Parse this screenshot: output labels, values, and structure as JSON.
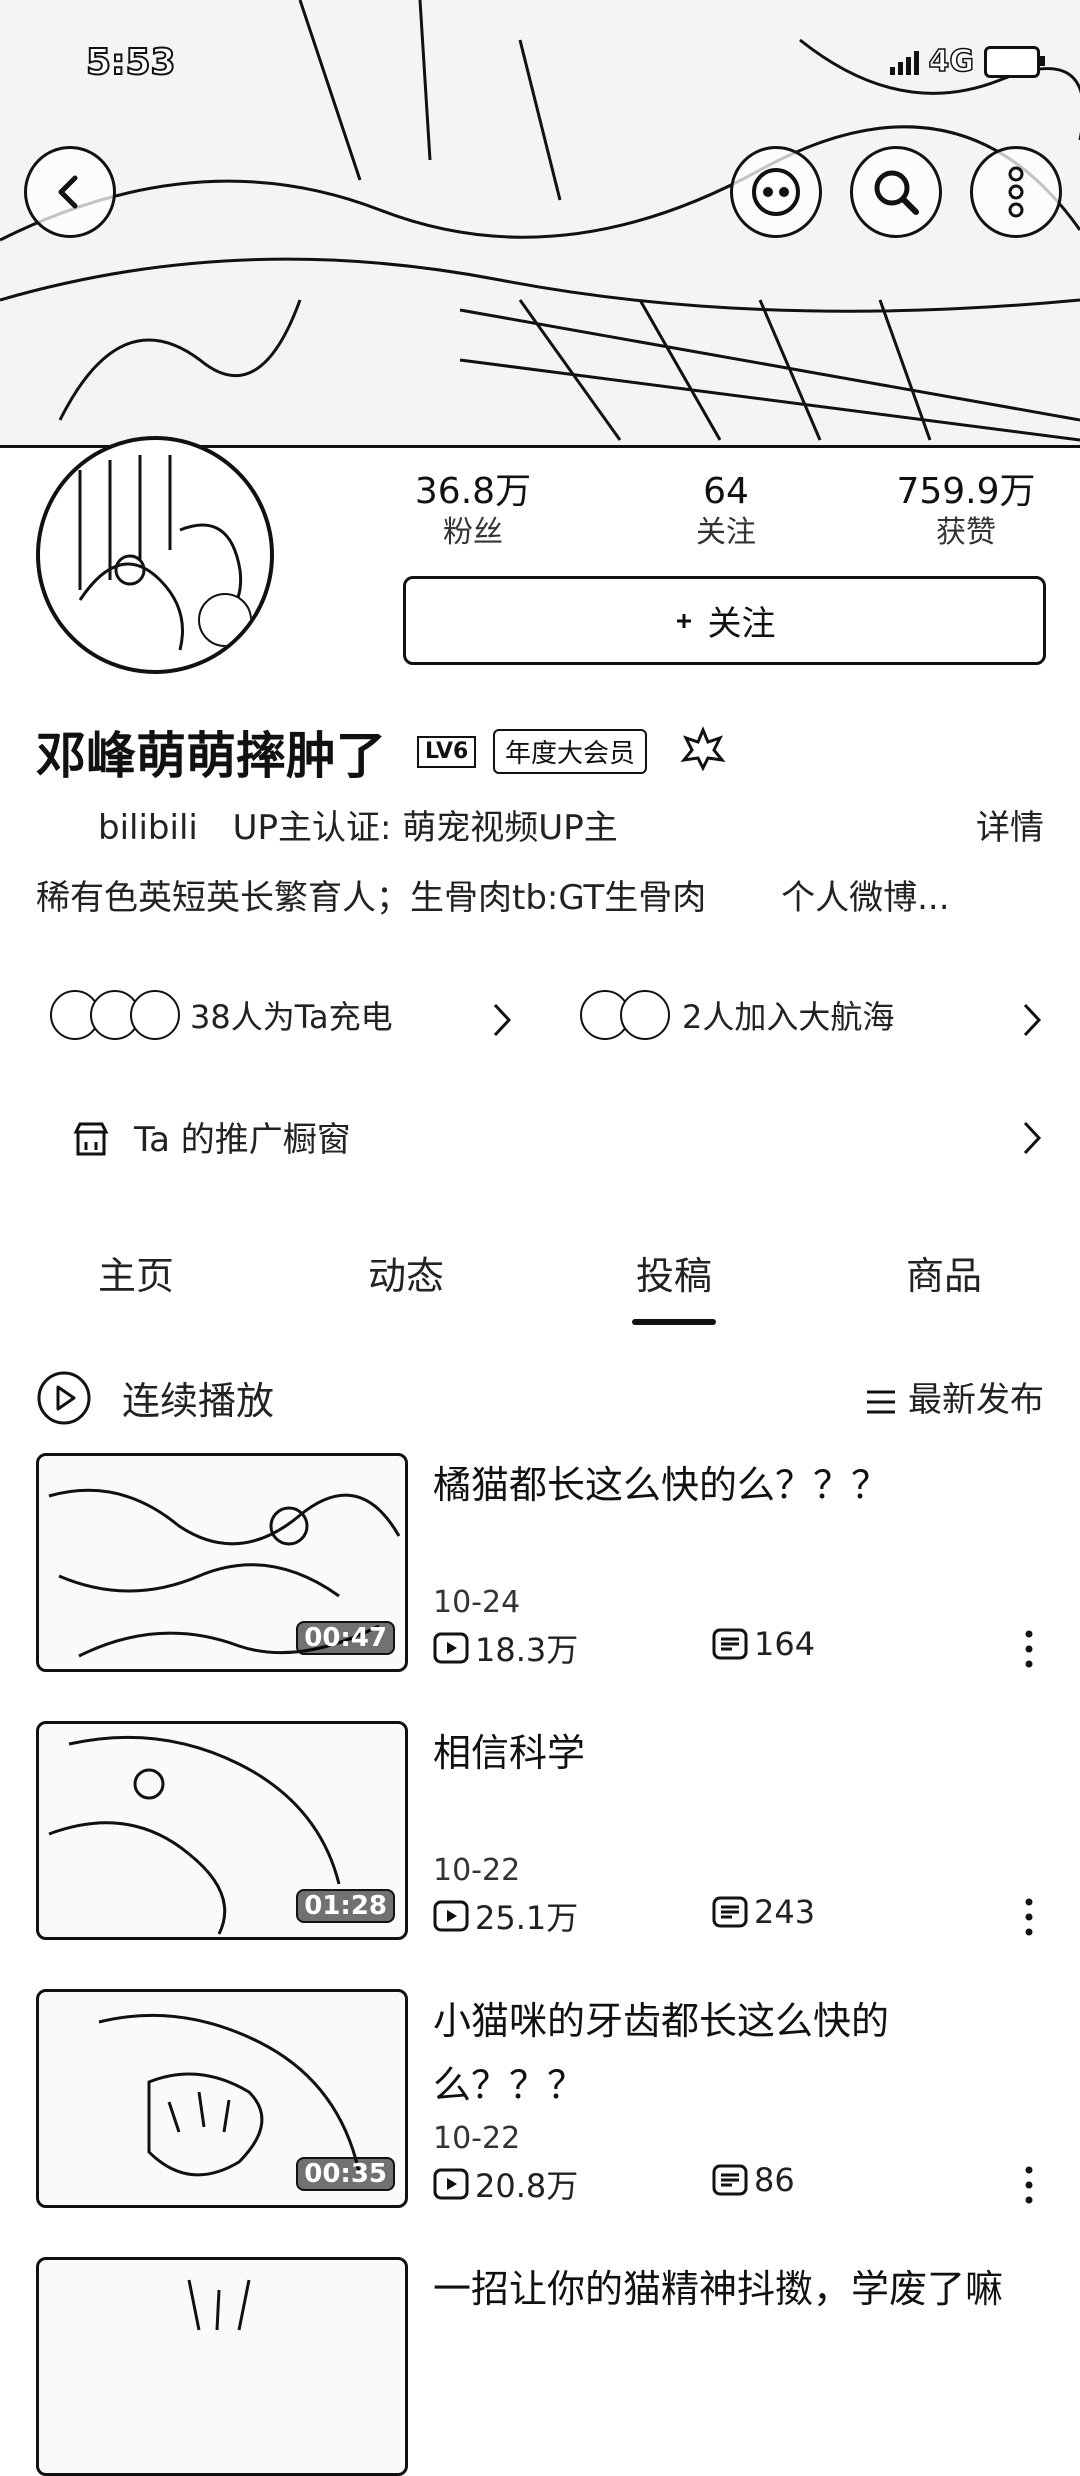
{
  "status": {
    "time": "5:53",
    "network": "4G"
  },
  "stats": [
    {
      "value": "36.8万",
      "label": "粉丝"
    },
    {
      "value": "64",
      "label": "关注"
    },
    {
      "value": "759.9万",
      "label": "获赞"
    }
  ],
  "follow_label": "关注",
  "profile": {
    "name": "邓峰萌萌摔肿了",
    "level_badge": "LV6",
    "vip_badge": "年度大会员",
    "cert_source": "bilibili",
    "cert_text": "UP主认证:  萌宠视频UP主",
    "detail_link": "详情",
    "bio": "稀有色英短英长繁育人；生骨肉tb:GT生骨肉",
    "weibo": "个人微博..."
  },
  "charge": {
    "text": "38人为Ta充电"
  },
  "fleet": {
    "text": "2人加入大航海"
  },
  "showcase": {
    "text": "Ta 的推广橱窗"
  },
  "tabs": [
    "主页",
    "动态",
    "投稿",
    "商品"
  ],
  "active_tab": "投稿",
  "play_all": "连续播放",
  "sort": "最新发布",
  "videos": [
    {
      "title": "橘猫都长这么快的么？？？",
      "date": "10-24",
      "plays": "18.3万",
      "danmaku": "164",
      "duration": "00:47"
    },
    {
      "title": "相信科学",
      "date": "10-22",
      "plays": "25.1万",
      "danmaku": "243",
      "duration": "01:28"
    },
    {
      "title": "小猫咪的牙齿都长这么快的么？？？",
      "date": "10-22",
      "plays": "20.8万",
      "danmaku": "86",
      "duration": "00:35"
    },
    {
      "title": "一招让你的猫精神抖擞，学废了嘛"
    }
  ],
  "icons": {
    "back": "chevron-left-icon",
    "face": "bilibili-face-icon",
    "search": "search-icon",
    "more": "more-vertical-icon",
    "play": "play-circle-icon",
    "sort": "list-sort-icon",
    "shop": "shop-icon",
    "medal": "medal-icon"
  }
}
